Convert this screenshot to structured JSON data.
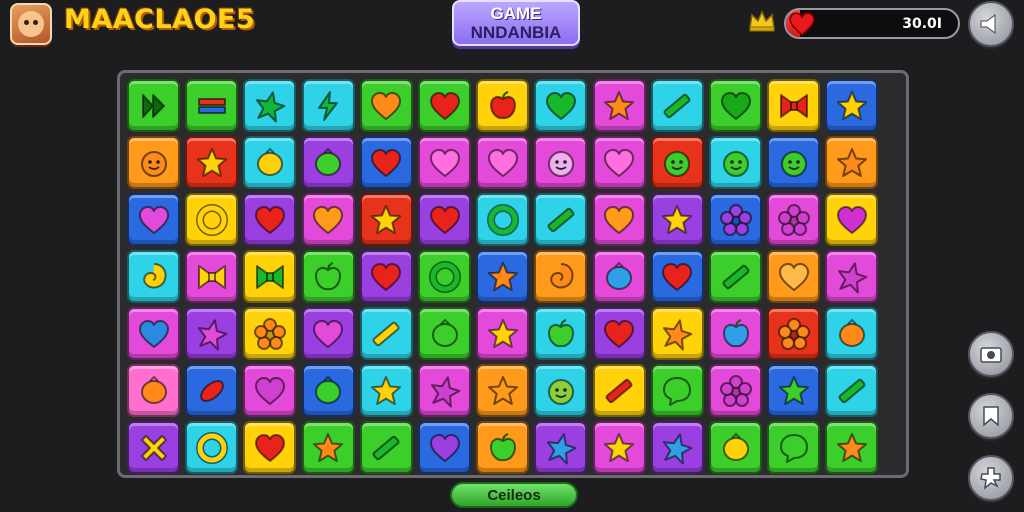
{
  "header": {
    "brand": "MAACLAOE5",
    "title_line1": "GAME",
    "title_line2": "NNDANBIA",
    "lives_text": "30.0I",
    "lives_level": 0.08,
    "icons": {
      "avatar": "avatar-face",
      "crown": "crown-icon",
      "heart": "heart-icon",
      "menu": "speaker-icon"
    }
  },
  "side_buttons": [
    {
      "name": "camera-button",
      "icon": "camera-icon"
    },
    {
      "name": "bookmark-button",
      "icon": "bookmark-icon"
    },
    {
      "name": "puzzle-button",
      "icon": "puzzle-icon"
    }
  ],
  "footer": {
    "button_label": "Ceileos"
  },
  "colors": {
    "green": "#3ccf2c",
    "cyan": "#2fd3e8",
    "red": "#e8331c",
    "yellow": "#ffd20a",
    "magenta": "#e44ad9",
    "purple": "#9a3fe0",
    "blue": "#2a69e0",
    "orange": "#ff9a1a",
    "pink": "#ff6fcf",
    "teal": "#36c9d4"
  },
  "board": {
    "rows": [
      [
        {
          "bg": "green",
          "icon": "play",
          "fg": "#0e6a08"
        },
        {
          "bg": "green",
          "icon": "bars",
          "fg": "#e8331c"
        },
        {
          "bg": "cyan",
          "icon": "star4",
          "fg": "#0fb83a"
        },
        {
          "bg": "cyan",
          "icon": "bolt",
          "fg": "#0fb83a"
        },
        {
          "bg": "green",
          "icon": "heart",
          "fg": "#ff8a1a"
        },
        {
          "bg": "green",
          "icon": "heart",
          "fg": "#e8231c"
        },
        {
          "bg": "yellow",
          "icon": "apple",
          "fg": "#e8231c"
        },
        {
          "bg": "cyan",
          "icon": "heart",
          "fg": "#19b82a"
        },
        {
          "bg": "magenta",
          "icon": "star",
          "fg": "#ff8a1a"
        },
        {
          "bg": "cyan",
          "icon": "stick",
          "fg": "#19b82a"
        },
        {
          "bg": "green",
          "icon": "heart",
          "fg": "#18a818"
        },
        {
          "bg": "yellow",
          "icon": "bowtie",
          "fg": "#e8231c"
        },
        {
          "bg": "blue",
          "icon": "star",
          "fg": "#ffd20a"
        }
      ],
      [
        {
          "bg": "orange",
          "icon": "face",
          "fg": "#ff8a1a"
        },
        {
          "bg": "red",
          "icon": "star",
          "fg": "#ffd20a"
        },
        {
          "bg": "cyan",
          "icon": "blob",
          "fg": "#ffd20a"
        },
        {
          "bg": "purple",
          "icon": "blob",
          "fg": "#3ccf2c"
        },
        {
          "bg": "blue",
          "icon": "heart",
          "fg": "#e8231c"
        },
        {
          "bg": "magenta",
          "icon": "heart",
          "fg": "#ff6fe0"
        },
        {
          "bg": "magenta",
          "icon": "heart",
          "fg": "#ff6fe0"
        },
        {
          "bg": "magenta",
          "icon": "face",
          "fg": "#f0b0f0"
        },
        {
          "bg": "magenta",
          "icon": "heart",
          "fg": "#ff6fe0"
        },
        {
          "bg": "red",
          "icon": "face",
          "fg": "#3ccf2c"
        },
        {
          "bg": "cyan",
          "icon": "face",
          "fg": "#3ccf2c"
        },
        {
          "bg": "blue",
          "icon": "face",
          "fg": "#3ccf2c"
        },
        {
          "bg": "orange",
          "icon": "star",
          "fg": "#ff8a1a"
        }
      ],
      [
        {
          "bg": "blue",
          "icon": "heart",
          "fg": "#e44ad9"
        },
        {
          "bg": "yellow",
          "icon": "ring",
          "fg": "#ffd20a"
        },
        {
          "bg": "purple",
          "icon": "heart",
          "fg": "#e8231c"
        },
        {
          "bg": "magenta",
          "icon": "heart",
          "fg": "#ff9a1a"
        },
        {
          "bg": "red",
          "icon": "star",
          "fg": "#ffd20a"
        },
        {
          "bg": "purple",
          "icon": "heart",
          "fg": "#e8231c"
        },
        {
          "bg": "cyan",
          "icon": "ring",
          "fg": "#19b82a"
        },
        {
          "bg": "cyan",
          "icon": "stick",
          "fg": "#19b82a"
        },
        {
          "bg": "magenta",
          "icon": "heart",
          "fg": "#ff9a1a"
        },
        {
          "bg": "purple",
          "icon": "star",
          "fg": "#ffd20a"
        },
        {
          "bg": "blue",
          "icon": "flower",
          "fg": "#9a3fe0"
        },
        {
          "bg": "magenta",
          "icon": "flower",
          "fg": "#d040d0"
        },
        {
          "bg": "yellow",
          "icon": "heart",
          "fg": "#d030d0"
        }
      ],
      [
        {
          "bg": "cyan",
          "icon": "swirl",
          "fg": "#ffd20a"
        },
        {
          "bg": "magenta",
          "icon": "bowtie",
          "fg": "#ffd20a"
        },
        {
          "bg": "yellow",
          "icon": "bowtie",
          "fg": "#19b82a"
        },
        {
          "bg": "green",
          "icon": "apple",
          "fg": "#3ccf2c"
        },
        {
          "bg": "purple",
          "icon": "heart",
          "fg": "#e8231c"
        },
        {
          "bg": "green",
          "icon": "ring",
          "fg": "#19b82a"
        },
        {
          "bg": "blue",
          "icon": "star",
          "fg": "#ff8a1a"
        },
        {
          "bg": "orange",
          "icon": "swirl",
          "fg": "#ff8a1a"
        },
        {
          "bg": "magenta",
          "icon": "blob",
          "fg": "#2fa0e8"
        },
        {
          "bg": "blue",
          "icon": "heart",
          "fg": "#e8231c"
        },
        {
          "bg": "green",
          "icon": "stick",
          "fg": "#19b82a"
        },
        {
          "bg": "orange",
          "icon": "heart",
          "fg": "#ffb84a"
        },
        {
          "bg": "magenta",
          "icon": "star4",
          "fg": "#d040d0"
        }
      ],
      [
        {
          "bg": "magenta",
          "icon": "heart",
          "fg": "#2a8ae0"
        },
        {
          "bg": "purple",
          "icon": "star4",
          "fg": "#e44ad9"
        },
        {
          "bg": "yellow",
          "icon": "flower",
          "fg": "#ff8a1a"
        },
        {
          "bg": "purple",
          "icon": "heart",
          "fg": "#e44ad9"
        },
        {
          "bg": "cyan",
          "icon": "stick",
          "fg": "#ffd20a"
        },
        {
          "bg": "green",
          "icon": "blob",
          "fg": "#3ccf2c"
        },
        {
          "bg": "magenta",
          "icon": "star",
          "fg": "#ffd20a"
        },
        {
          "bg": "cyan",
          "icon": "apple",
          "fg": "#3ccf2c"
        },
        {
          "bg": "purple",
          "icon": "heart",
          "fg": "#e8231c"
        },
        {
          "bg": "yellow",
          "icon": "star4",
          "fg": "#ff8a1a"
        },
        {
          "bg": "magenta",
          "icon": "apple",
          "fg": "#2fa0e8"
        },
        {
          "bg": "red",
          "icon": "flower",
          "fg": "#ff8a1a"
        },
        {
          "bg": "cyan",
          "icon": "blob",
          "fg": "#ff8a1a"
        }
      ],
      [
        {
          "bg": "pink",
          "icon": "blob",
          "fg": "#ff8a1a"
        },
        {
          "bg": "blue",
          "icon": "bean",
          "fg": "#e8231c"
        },
        {
          "bg": "magenta",
          "icon": "heart",
          "fg": "#d040d0"
        },
        {
          "bg": "blue",
          "icon": "blob",
          "fg": "#3ccf2c"
        },
        {
          "bg": "cyan",
          "icon": "star",
          "fg": "#ffd20a"
        },
        {
          "bg": "magenta",
          "icon": "star4",
          "fg": "#d040d0"
        },
        {
          "bg": "orange",
          "icon": "star",
          "fg": "#ff9a1a"
        },
        {
          "bg": "cyan",
          "icon": "face",
          "fg": "#8ad03a"
        },
        {
          "bg": "yellow",
          "icon": "stick",
          "fg": "#e8231c"
        },
        {
          "bg": "green",
          "icon": "chat",
          "fg": "#3ccf2c"
        },
        {
          "bg": "magenta",
          "icon": "flower",
          "fg": "#d040d0"
        },
        {
          "bg": "blue",
          "icon": "star",
          "fg": "#3ccf2c"
        },
        {
          "bg": "cyan",
          "icon": "stick",
          "fg": "#19b82a"
        }
      ],
      [
        {
          "bg": "purple",
          "icon": "x",
          "fg": "#ffd20a"
        },
        {
          "bg": "cyan",
          "icon": "ring",
          "fg": "#ffd20a"
        },
        {
          "bg": "yellow",
          "icon": "heart",
          "fg": "#e8231c"
        },
        {
          "bg": "green",
          "icon": "star",
          "fg": "#ff8a1a"
        },
        {
          "bg": "green",
          "icon": "stick",
          "fg": "#19b82a"
        },
        {
          "bg": "blue",
          "icon": "heart",
          "fg": "#9a3fe0"
        },
        {
          "bg": "orange",
          "icon": "apple",
          "fg": "#3ccf2c"
        },
        {
          "bg": "purple",
          "icon": "star4",
          "fg": "#2fa0e8"
        },
        {
          "bg": "magenta",
          "icon": "star",
          "fg": "#ffd20a"
        },
        {
          "bg": "purple",
          "icon": "star4",
          "fg": "#2fa0e8"
        },
        {
          "bg": "green",
          "icon": "blob",
          "fg": "#ffd20a"
        },
        {
          "bg": "green",
          "icon": "chat",
          "fg": "#3ccf2c"
        },
        {
          "bg": "green",
          "icon": "star",
          "fg": "#ff8a1a"
        }
      ]
    ]
  }
}
